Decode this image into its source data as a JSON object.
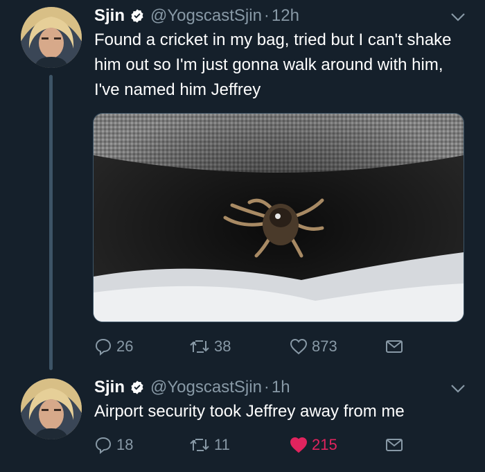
{
  "tweets": [
    {
      "display_name": "Sjin",
      "handle": "@YogscastSjin",
      "separator": "·",
      "time": "12h",
      "text": "Found a cricket in my bag, tried but I can't shake him out so I'm just gonna walk around with him, I've named him Jeffrey",
      "counts": {
        "replies": "26",
        "retweets": "38",
        "likes": "873"
      },
      "liked": false
    },
    {
      "display_name": "Sjin",
      "handle": "@YogscastSjin",
      "separator": "·",
      "time": "1h",
      "text": "Airport security took Jeffrey away from me",
      "counts": {
        "replies": "18",
        "retweets": "11",
        "likes": "215"
      },
      "liked": true
    }
  ],
  "colors": {
    "background": "#15202b",
    "secondary_text": "#8899a6",
    "verified_badge": "#ffffff",
    "like_active": "#e0245e",
    "thread_line": "#3d5466"
  },
  "icons": {
    "reply": "reply-icon",
    "retweet": "retweet-icon",
    "like": "heart-icon",
    "share": "share-mail-icon",
    "verified": "verified-badge-icon",
    "caret": "chevron-down-icon"
  }
}
